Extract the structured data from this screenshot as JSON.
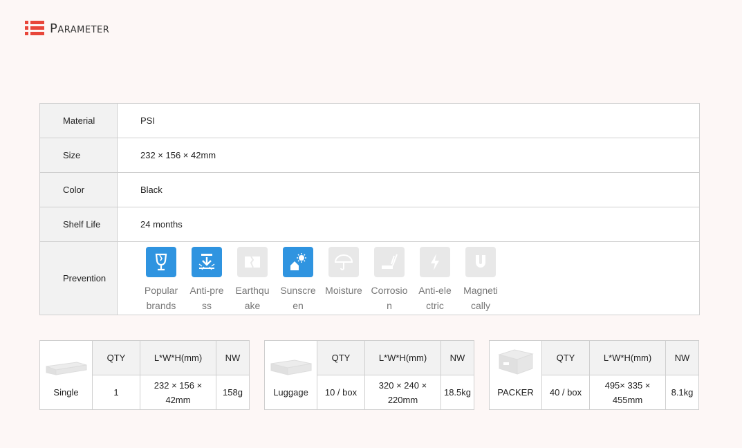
{
  "header": {
    "title": "Parameter"
  },
  "spec": {
    "rows": [
      {
        "label": "Material",
        "value": "PSI"
      },
      {
        "label": "Size",
        "value": "232 × 156 × 42mm"
      },
      {
        "label": "Color",
        "value": "Black"
      },
      {
        "label": "Shelf Life",
        "value": "24 months"
      }
    ],
    "prevention": {
      "label": "Prevention",
      "items": [
        {
          "name": "Popular brands",
          "icon": "broken-glass-icon",
          "active": true
        },
        {
          "name": "Anti-press",
          "icon": "press-arrow-icon",
          "active": true
        },
        {
          "name": "Earthquake",
          "icon": "cracked-wall-icon",
          "active": false
        },
        {
          "name": "Sunscreen",
          "icon": "sun-house-icon",
          "active": true
        },
        {
          "name": "Moisture",
          "icon": "umbrella-icon",
          "active": false
        },
        {
          "name": "Corrosion",
          "icon": "corrosion-icon",
          "active": false
        },
        {
          "name": "Anti-electric",
          "icon": "lightning-icon",
          "active": false
        },
        {
          "name": "Magnetically",
          "icon": "magnet-icon",
          "active": false
        }
      ]
    }
  },
  "packing": [
    {
      "name": "Single",
      "headers": [
        "QTY",
        "L*W*H(mm)",
        "NW"
      ],
      "qty": "1",
      "dims": "232 × 156 × 42mm",
      "nw": "158g"
    },
    {
      "name": "Luggage",
      "headers": [
        "QTY",
        "L*W*H(mm)",
        "NW"
      ],
      "qty": "10 / box",
      "dims": "320 × 240 × 220mm",
      "nw": "18.5kg"
    },
    {
      "name": "PACKER",
      "headers": [
        "QTY",
        "L*W*H(mm)",
        "NW"
      ],
      "qty": "40 / box",
      "dims": "495× 335 × 455mm",
      "nw": "8.1kg"
    }
  ],
  "colors": {
    "accent": "#e8463a",
    "active_icon": "#2f94e0",
    "inactive_icon": "#e8e8e8"
  }
}
